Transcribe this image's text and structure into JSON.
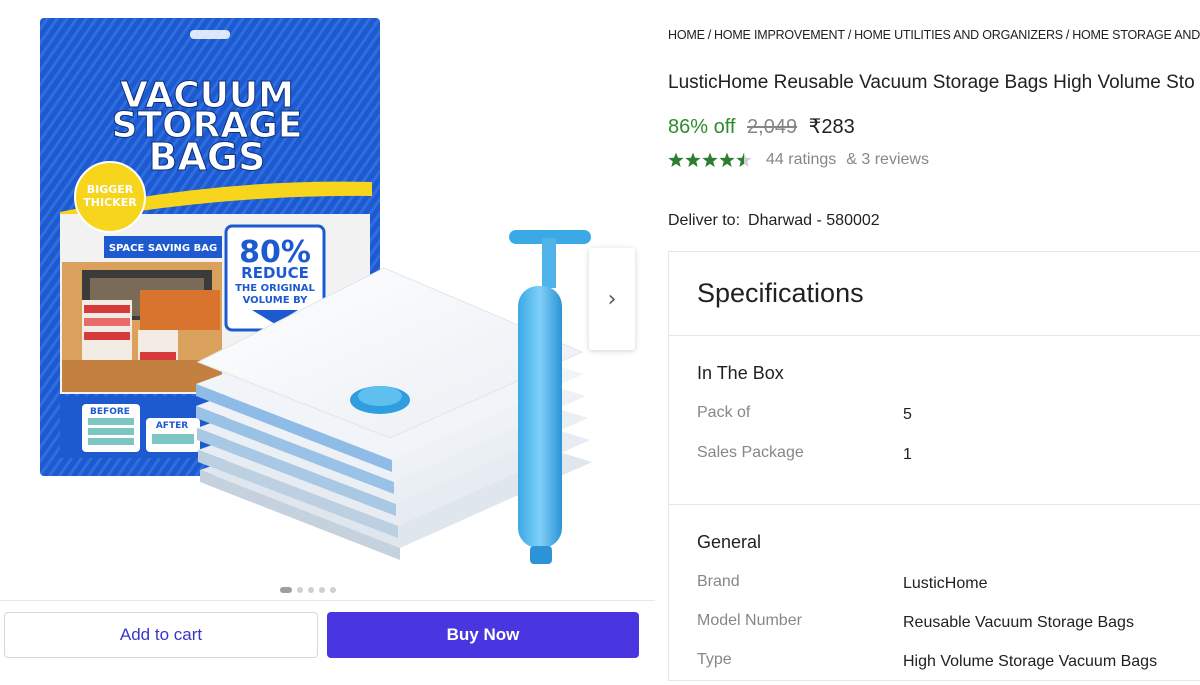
{
  "product_image": {
    "package_title_lines": [
      "VACUUM",
      "STORAGE",
      "BAGS"
    ],
    "badge": [
      "BIGGER",
      "THICKER"
    ],
    "space_saving_label": "SPACE SAVING BAG",
    "reduce_percent": "80%",
    "reduce_lines": [
      "REDUCE",
      "THE ORIGINAL",
      "VOLUME BY"
    ],
    "before_label": "BEFORE",
    "after_label": "AFTER",
    "next_icon": "chevron-right-icon",
    "total_images": 5,
    "active_image": 1
  },
  "actions": {
    "add_to_cart": "Add to cart",
    "buy_now": "Buy Now"
  },
  "breadcrumb": [
    "HOME",
    "HOME IMPROVEMENT",
    "HOME UTILITIES AND ORGANIZERS",
    "HOME STORAGE AND ORG"
  ],
  "product": {
    "title": "LusticHome Reusable Vacuum Storage Bags High Volume Sto",
    "discount": "86% off",
    "mrp": "2,049",
    "price": "₹283",
    "rating_value": 4.5,
    "ratings_text": "44 ratings",
    "reviews_text": "& 3 reviews"
  },
  "delivery": {
    "label": "Deliver to:",
    "location": "Dharwad - 580002"
  },
  "specifications": {
    "heading": "Specifications",
    "sections": [
      {
        "title": "In The Box",
        "rows": [
          {
            "label": "Pack of",
            "value": "5"
          },
          {
            "label": "Sales Package",
            "value": "1"
          }
        ]
      },
      {
        "title": "General",
        "rows": [
          {
            "label": "Brand",
            "value": "LusticHome"
          },
          {
            "label": "Model Number",
            "value": "Reusable Vacuum Storage Bags"
          },
          {
            "label": "Type",
            "value": "High Volume Storage Vacuum Bags"
          }
        ]
      }
    ]
  },
  "colors": {
    "brand_blue": "#4a36e0",
    "discount_green": "#2e8b2e",
    "star_green": "#2e7d32",
    "package_blue": "#1c56c9"
  }
}
